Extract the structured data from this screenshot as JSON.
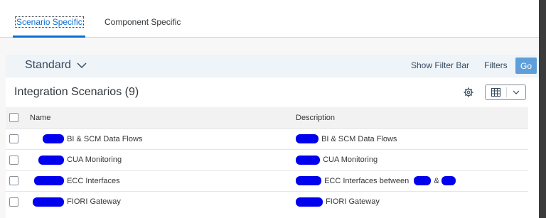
{
  "tabs": [
    {
      "label": "Scenario Specific",
      "active": true
    },
    {
      "label": "Component Specific",
      "active": false
    }
  ],
  "filter_bar": {
    "variant": "Standard",
    "show_filter_bar": "Show Filter Bar",
    "filters": "Filters",
    "go": "Go"
  },
  "table": {
    "title": "Integration Scenarios (9)",
    "columns": [
      "Name",
      "Description"
    ],
    "rows": [
      {
        "name": "BI & SCM Data Flows",
        "description": "BI & SCM Data Flows"
      },
      {
        "name": "CUA Monitoring",
        "description": "CUA Monitoring"
      },
      {
        "name": "ECC Interfaces",
        "description": "ECC Interfaces between",
        "description_suffix": "&"
      },
      {
        "name": "FIORI Gateway",
        "description": "FIORI Gateway"
      }
    ]
  },
  "colors": {
    "accent": "#0a6ed1",
    "go_button": "#5f9fd9",
    "filter_bar_bg": "#eff4f9",
    "redaction": "#0000ee"
  },
  "icons": {
    "variant_dropdown": "chevron-down-icon",
    "settings": "gear-icon",
    "export": "spreadsheet-export-icon",
    "export_menu": "chevron-down-icon"
  }
}
